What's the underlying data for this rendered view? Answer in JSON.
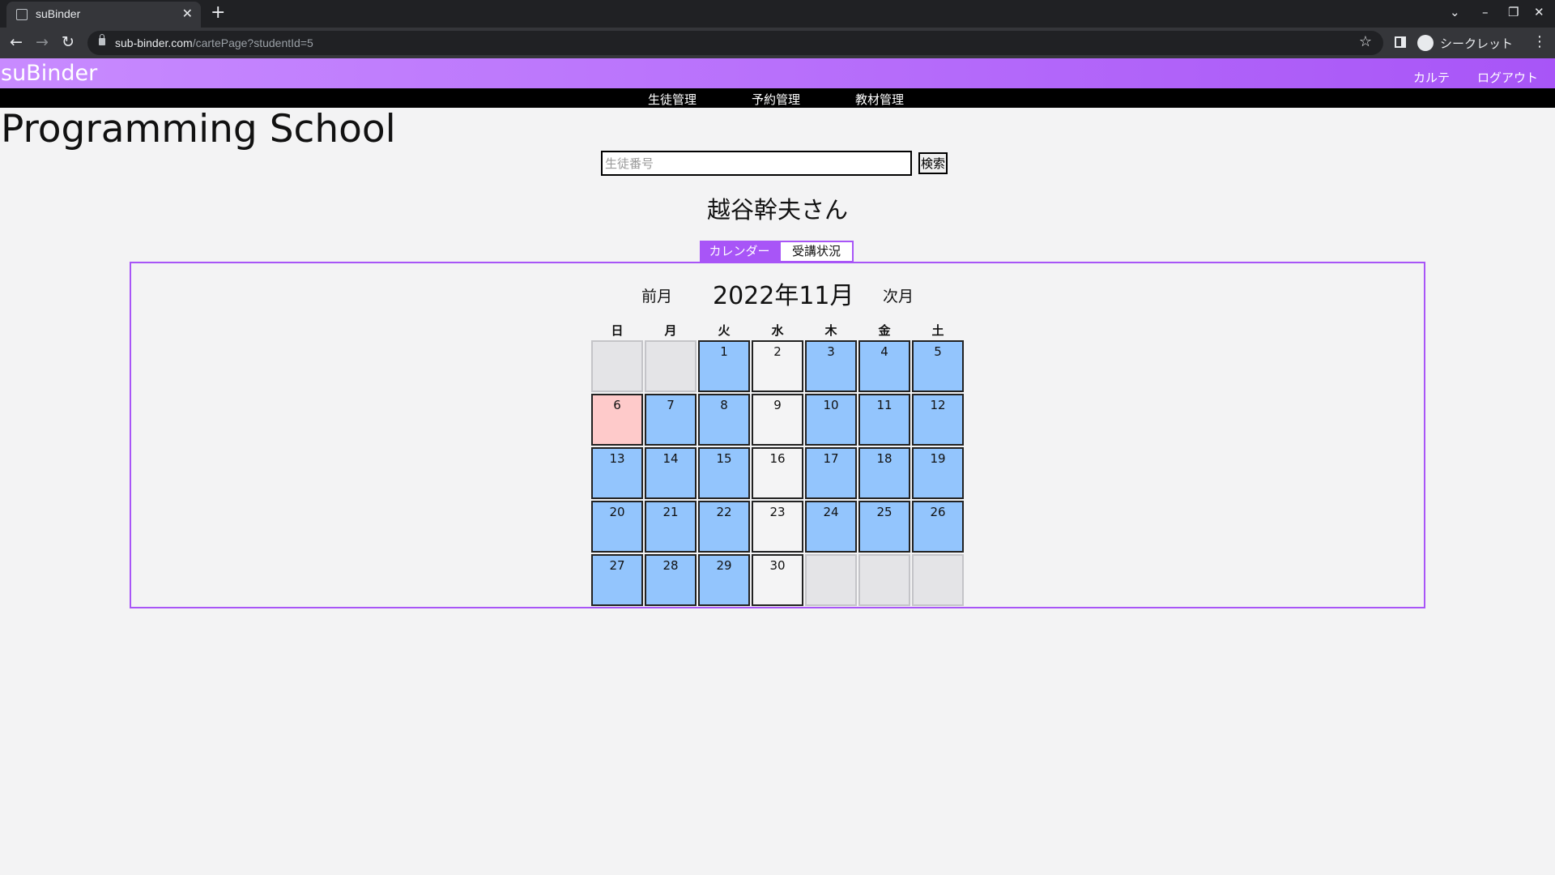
{
  "browser": {
    "tab_title": "suBinder",
    "url_host": "sub-binder.com",
    "url_path": "/cartePage?studentId=5",
    "incognito_label": "シークレット"
  },
  "header": {
    "brand": "suBinder",
    "links": [
      "カルテ",
      "ログアウト"
    ]
  },
  "nav": {
    "items": [
      "生徒管理",
      "予約管理",
      "教材管理"
    ]
  },
  "page": {
    "title": "Programming School"
  },
  "search": {
    "placeholder": "生徒番号",
    "value": "",
    "button_label": "検索"
  },
  "student": {
    "name": "越谷幹夫さん"
  },
  "tabs": [
    "カレンダー",
    "受講状況"
  ],
  "calendar": {
    "prev_label": "前月",
    "month_label": "2022年11月",
    "next_label": "次月",
    "weekdays": [
      "日",
      "月",
      "火",
      "水",
      "木",
      "金",
      "土"
    ],
    "colors": {
      "blue": "#93c5fd",
      "white": "#f4f4f5",
      "pink": "#fecaca",
      "empty": "#e4e4e7"
    },
    "weeks": [
      [
        {
          "day": "",
          "status": "empty"
        },
        {
          "day": "",
          "status": "empty"
        },
        {
          "day": "1",
          "status": "blue"
        },
        {
          "day": "2",
          "status": "white"
        },
        {
          "day": "3",
          "status": "blue"
        },
        {
          "day": "4",
          "status": "blue"
        },
        {
          "day": "5",
          "status": "blue"
        }
      ],
      [
        {
          "day": "6",
          "status": "pink"
        },
        {
          "day": "7",
          "status": "blue"
        },
        {
          "day": "8",
          "status": "blue"
        },
        {
          "day": "9",
          "status": "white"
        },
        {
          "day": "10",
          "status": "blue"
        },
        {
          "day": "11",
          "status": "blue"
        },
        {
          "day": "12",
          "status": "blue"
        }
      ],
      [
        {
          "day": "13",
          "status": "blue"
        },
        {
          "day": "14",
          "status": "blue"
        },
        {
          "day": "15",
          "status": "blue"
        },
        {
          "day": "16",
          "status": "white"
        },
        {
          "day": "17",
          "status": "blue"
        },
        {
          "day": "18",
          "status": "blue"
        },
        {
          "day": "19",
          "status": "blue"
        }
      ],
      [
        {
          "day": "20",
          "status": "blue"
        },
        {
          "day": "21",
          "status": "blue"
        },
        {
          "day": "22",
          "status": "blue"
        },
        {
          "day": "23",
          "status": "white"
        },
        {
          "day": "24",
          "status": "blue"
        },
        {
          "day": "25",
          "status": "blue"
        },
        {
          "day": "26",
          "status": "blue"
        }
      ],
      [
        {
          "day": "27",
          "status": "blue"
        },
        {
          "day": "28",
          "status": "blue"
        },
        {
          "day": "29",
          "status": "blue"
        },
        {
          "day": "30",
          "status": "white"
        },
        {
          "day": "",
          "status": "empty"
        },
        {
          "day": "",
          "status": "empty"
        },
        {
          "day": "",
          "status": "empty"
        }
      ]
    ]
  }
}
